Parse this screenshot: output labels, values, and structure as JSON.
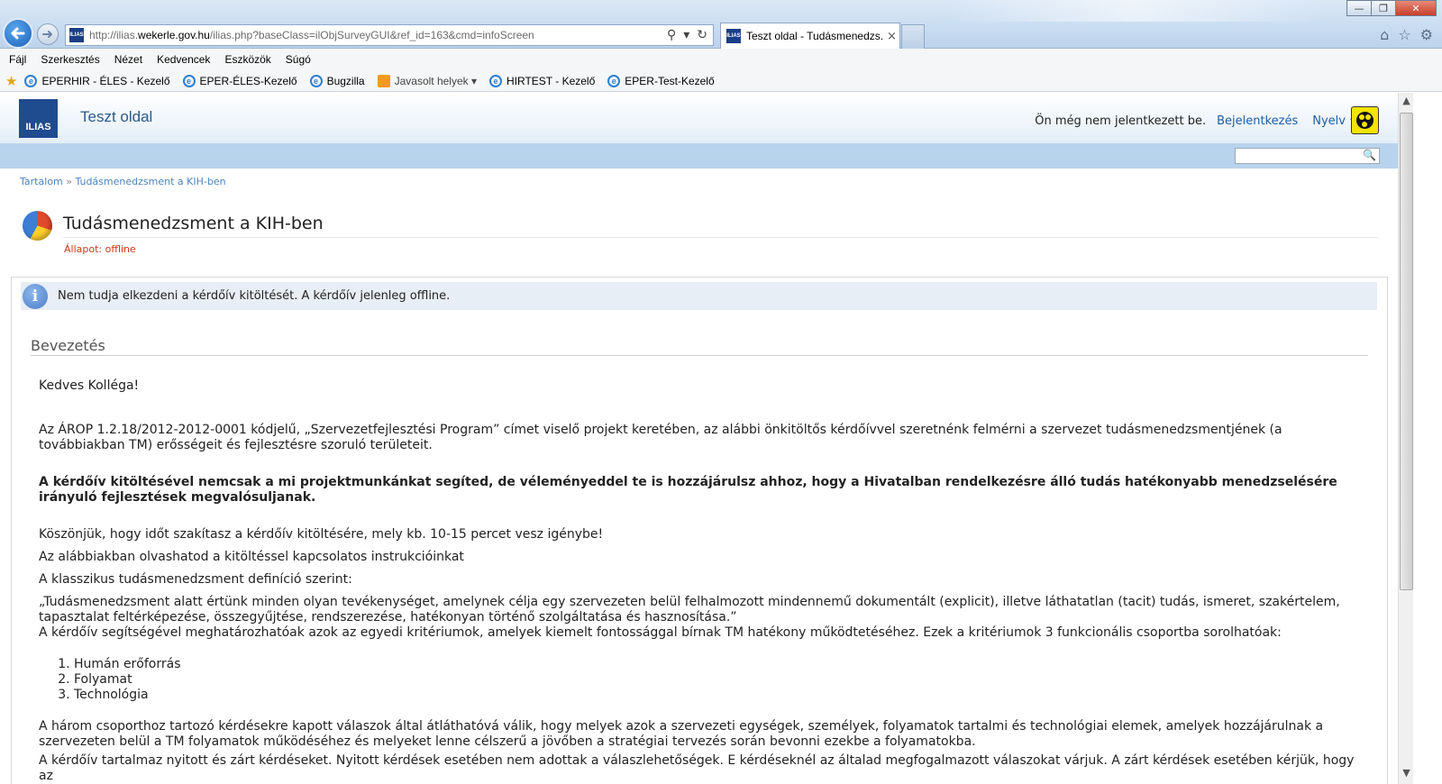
{
  "browser": {
    "url_prefix": "http://ilias.",
    "url_domain": "wekerle.gov.hu",
    "url_rest": "/ilias.php?baseClass=ilObjSurveyGUI&ref_id=163&cmd=infoScreen",
    "tab_title": "Teszt oldal - Tudásmenedzs...",
    "tab_close": "×",
    "favicon_text": "ILIAS",
    "menu": [
      "Fájl",
      "Szerkesztés",
      "Nézet",
      "Kedvencek",
      "Eszközök",
      "Súgó"
    ],
    "favorites": [
      "EPERHIR - ÉLES - Kezelő",
      "EPER-ÉLES-Kezelő",
      "Bugzilla",
      "Javasolt helyek ▾",
      "HIRTEST - Kezelő",
      "EPER-Test-Kezelő"
    ]
  },
  "ilias": {
    "logo": "ILIAS",
    "site_title": "Teszt oldal",
    "not_logged_in": "Ön még nem jelentkezett be.",
    "login": "Bejelentkezés",
    "language": "Nyelv"
  },
  "breadcrumb": {
    "root": "Tartalom",
    "sep": "»",
    "current": "Tudásmenedzsment a KIH-ben"
  },
  "object": {
    "title": "Tudásmenedzsment a KIH-ben",
    "status": "Állapot: offline"
  },
  "info_message": "Nem tudja elkezdeni a kérdőív kitöltését. A kérdőív jelenleg offline.",
  "section_title": "Bevezetés",
  "content": {
    "greeting": "Kedves Kolléga!",
    "p1": "Az ÁROP 1.2.18/2012-2012-0001 kódjelű, „Szervezetfejlesztési Program” címet viselő projekt keretében, az alábbi önkitöltős kérdőívvel szeretnénk felmérni a szervezet tudásmenedzsmentjének (a továbbiakban TM) erősségeit és fejlesztésre szoruló területeit.",
    "p2_bold": "A kérdőív kitöltésével nemcsak a mi projektmunkánkat segíted, de véleményeddel te is hozzájárulsz ahhoz, hogy a Hivatalban rendelkezésre álló tudás hatékonyabb menedzselésére irányuló fejlesztések megvalósuljanak.",
    "p3": "Köszönjük, hogy időt szakítasz a kérdőív kitöltésére, mely kb. 10-15 percet vesz igénybe!",
    "p4": "Az alábbiakban olvashatod a kitöltéssel  kapcsolatos instrukcióinkat",
    "p5": "A klasszikus tudásmenedzsment definíció szerint:",
    "p6": "„Tudásmenedzsment alatt értünk minden olyan tevékenységet, amelynek célja egy szervezeten belül felhalmozott mindennemű dokumentált (explicit), illetve láthatatlan (tacit) tudás, ismeret, szakértelem, tapasztalat feltérképezése, összegyűjtése, rendszerezése, hatékonyan történő szolgáltatása és hasznosítása.”",
    "p7": "A kérdőív segítségével meghatározhatóak azok az egyedi kritériumok, amelyek kiemelt fontossággal bírnak TM hatékony működtetéséhez. Ezek a kritériumok 3 funkcionális csoportba sorolhatóak:",
    "list": [
      "Humán erőforrás",
      "Folyamat",
      "Technológia"
    ],
    "p8": "A három csoporthoz tartozó kérdésekre kapott válaszok által átláthatóvá válik, hogy melyek azok a szervezeti egységek, személyek, folyamatok tartalmi és technológiai elemek, amelyek hozzájárulnak a szervezeten belül a TM folyamatok működéséhez és melyeket lenne célszerű a jövőben a stratégiai tervezés során bevonni ezekbe a folyamatokba.",
    "p9": "A kérdőív tartalmaz nyitott és zárt kérdéseket. Nyitott kérdések esetében nem adottak a válaszlehetőségek. E kérdéseknél az általad megfogalmazott válaszokat várjuk. A zárt kérdések esetében kérjük, hogy az"
  },
  "colors": {
    "ilias_bar": "#b8d3ec",
    "link": "#1b5fa8",
    "status_offline": "#cc3a1b",
    "info_bg": "#e8eef6"
  }
}
